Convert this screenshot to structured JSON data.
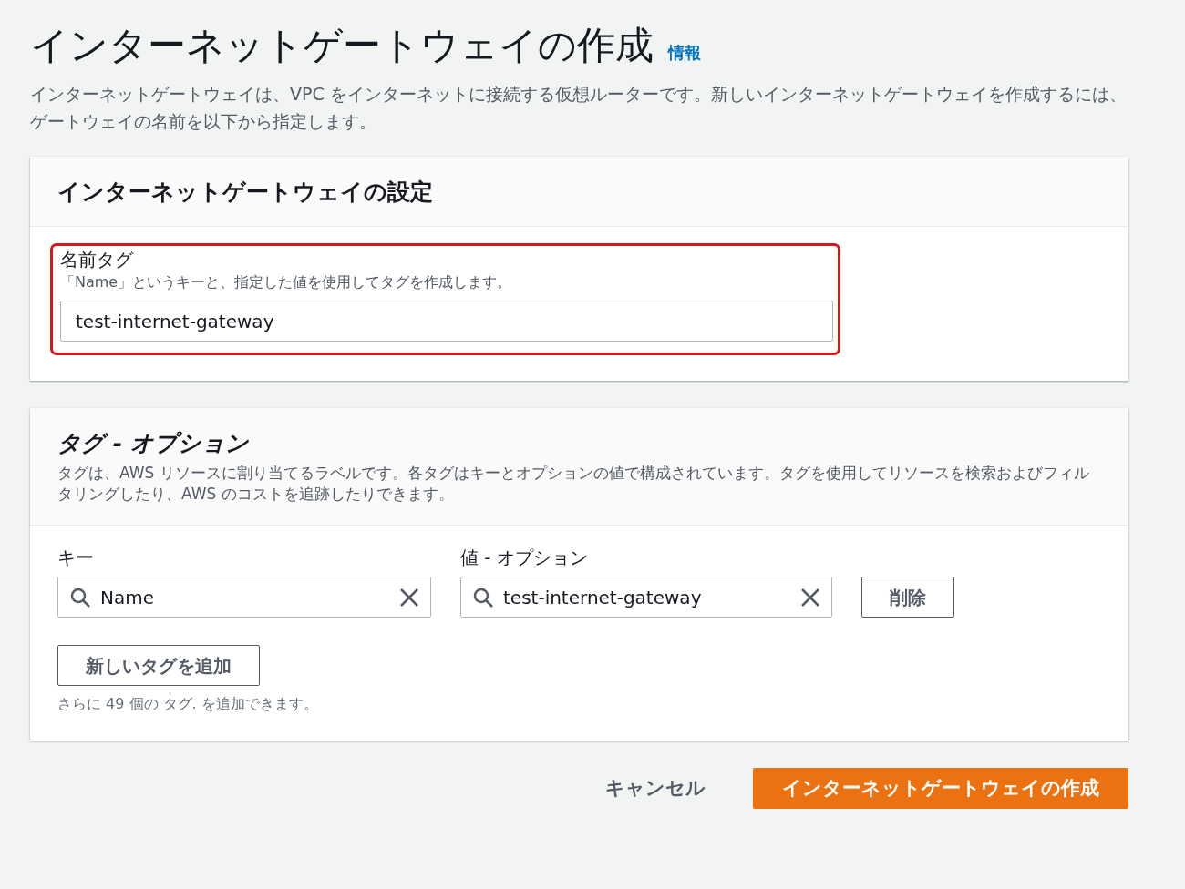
{
  "page": {
    "title": "インターネットゲートウェイの作成",
    "info_link": "情報",
    "description": "インターネットゲートウェイは、VPC をインターネットに接続する仮想ルーターです。新しいインターネットゲートウェイを作成するには、ゲートウェイの名前を以下から指定します。"
  },
  "settings_panel": {
    "title": "インターネットゲートウェイの設定",
    "name_tag": {
      "label": "名前タグ",
      "hint": "「Name」というキーと、指定した値を使用してタグを作成します。",
      "value": "test-internet-gateway",
      "highlighted": true
    }
  },
  "tags_panel": {
    "title": "タグ - オプション",
    "description": "タグは、AWS リソースに割り当てるラベルです。各タグはキーとオプションの値で構成されています。タグを使用してリソースを検索およびフィルタリングしたり、AWS のコストを追跡したりできます。",
    "key_label": "キー",
    "value_label": "値 - オプション",
    "tags": [
      {
        "key": "Name",
        "value": "test-internet-gateway",
        "remove_button": "削除"
      }
    ],
    "add_button": "新しいタグを追加",
    "limit_note": "さらに 49 個の タグ. を追加できます。"
  },
  "actions": {
    "cancel": "キャンセル",
    "create": "インターネットゲートウェイの作成"
  }
}
